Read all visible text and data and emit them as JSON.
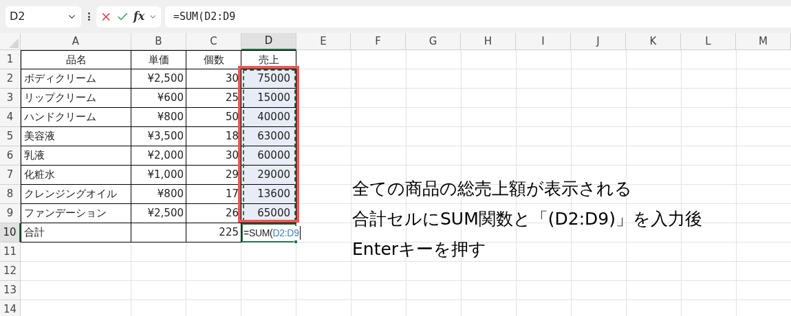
{
  "toolbar": {
    "name_box": "D2",
    "fx_label": "fx",
    "formula": "=SUM(D2:D9"
  },
  "columns": [
    {
      "label": "A",
      "selected": false
    },
    {
      "label": "B",
      "selected": false
    },
    {
      "label": "C",
      "selected": false
    },
    {
      "label": "D",
      "selected": true
    },
    {
      "label": "E",
      "selected": false
    },
    {
      "label": "F",
      "selected": false
    },
    {
      "label": "G",
      "selected": false
    },
    {
      "label": "H",
      "selected": false
    },
    {
      "label": "I",
      "selected": false
    },
    {
      "label": "J",
      "selected": false
    },
    {
      "label": "K",
      "selected": false
    },
    {
      "label": "L",
      "selected": false
    },
    {
      "label": "M",
      "selected": false
    }
  ],
  "rows": [
    {
      "number": "1",
      "selected": false,
      "kind": "header",
      "cells": [
        "品名",
        "単価",
        "個数",
        "売上"
      ]
    },
    {
      "number": "2",
      "selected": false,
      "kind": "data",
      "in_range": true,
      "cells": [
        "ボディクリーム",
        "¥2,500",
        "30",
        "75000"
      ]
    },
    {
      "number": "3",
      "selected": false,
      "kind": "data",
      "in_range": true,
      "cells": [
        "リップクリーム",
        "¥600",
        "25",
        "15000"
      ]
    },
    {
      "number": "4",
      "selected": false,
      "kind": "data",
      "in_range": true,
      "cells": [
        "ハンドクリーム",
        "¥800",
        "50",
        "40000"
      ]
    },
    {
      "number": "5",
      "selected": false,
      "kind": "data",
      "in_range": true,
      "cells": [
        "美容液",
        "¥3,500",
        "18",
        "63000"
      ]
    },
    {
      "number": "6",
      "selected": false,
      "kind": "data",
      "in_range": true,
      "cells": [
        "乳液",
        "¥2,000",
        "30",
        "60000"
      ]
    },
    {
      "number": "7",
      "selected": false,
      "kind": "data",
      "in_range": true,
      "cells": [
        "化粧水",
        "¥1,000",
        "29",
        "29000"
      ]
    },
    {
      "number": "8",
      "selected": false,
      "kind": "data",
      "in_range": true,
      "cells": [
        "クレンジングオイル",
        "¥800",
        "17",
        "13600"
      ]
    },
    {
      "number": "9",
      "selected": false,
      "kind": "data",
      "in_range": true,
      "cells": [
        "ファンデーション",
        "¥2,500",
        "26",
        "65000"
      ]
    },
    {
      "number": "10",
      "selected": true,
      "kind": "total",
      "cells": [
        "合計",
        null,
        "225",
        null
      ],
      "editing": {
        "function": "=SUM(",
        "ref": "D2:D9"
      }
    },
    {
      "number": "11",
      "selected": false,
      "kind": "empty"
    },
    {
      "number": "12",
      "selected": false,
      "kind": "empty"
    },
    {
      "number": "13",
      "selected": false,
      "kind": "empty"
    },
    {
      "number": "14",
      "selected": false,
      "kind": "empty"
    }
  ],
  "note": [
    "全ての商品の総売上額が表示される",
    "合計セルにSUM関数と「(D2:D9)」を入力後",
    "Enterキーを押す"
  ]
}
